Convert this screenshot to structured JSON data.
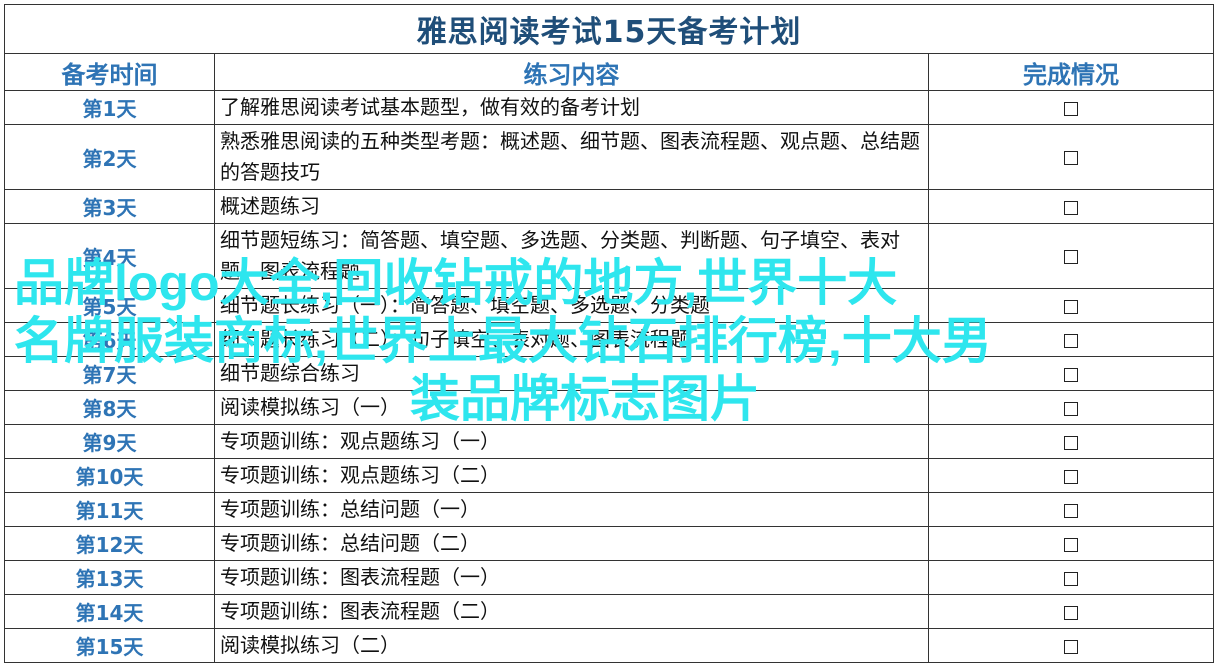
{
  "title": "雅思阅读考试15天备考计划",
  "headers": {
    "time": "备考时间",
    "content": "练习内容",
    "status": "完成情况"
  },
  "rows": [
    {
      "day": "第1天",
      "content": "了解雅思阅读考试基本题型，做有效的备考计划",
      "checked": false
    },
    {
      "day": "第2天",
      "content": "熟悉雅思阅读的五种类型考题：概述题、细节题、图表流程题、观点题、总结题的答题技巧",
      "checked": false
    },
    {
      "day": "第3天",
      "content": "概述题练习",
      "checked": false
    },
    {
      "day": "第4天",
      "content": "细节题短练习：简答题、填空题、多选题、分类题、判断题、句子填空、表对题、图表流程题",
      "checked": false
    },
    {
      "day": "第5天",
      "content": "细节题长练习（一）：简答题、填空题、多选题、分类题",
      "checked": false
    },
    {
      "day": "第6天",
      "content": "细节题长练习（二）：句子填空、表对题、图表流程题",
      "checked": false
    },
    {
      "day": "第7天",
      "content": "细节题综合练习",
      "checked": false
    },
    {
      "day": "第8天",
      "content": "阅读模拟练习（一）",
      "checked": false
    },
    {
      "day": "第9天",
      "content": "专项题训练：观点题练习（一）",
      "checked": false
    },
    {
      "day": "第10天",
      "content": "专项题训练：观点题练习（二）",
      "checked": false
    },
    {
      "day": "第11天",
      "content": "专项题训练：总结问题（一）",
      "checked": false
    },
    {
      "day": "第12天",
      "content": "专项题训练：总结问题（二）",
      "checked": false
    },
    {
      "day": "第13天",
      "content": "专项题训练：图表流程题（一）",
      "checked": false
    },
    {
      "day": "第14天",
      "content": "专项题训练：图表流程题（二）",
      "checked": false
    },
    {
      "day": "第15天",
      "content": "阅读模拟练习（二）",
      "checked": false
    }
  ],
  "checkbox_symbol": "☐",
  "overlay": {
    "line1": "品牌logo大全,回收钻戒的地方,世界十大",
    "line2": "名牌服装商标,世界上最大钻石排行榜,十大男",
    "line3": "装品牌标志图片"
  },
  "colors": {
    "title": "#1f4e79",
    "header": "#2e74b5",
    "day": "#2e74b5",
    "overlay": "#2ee6ee",
    "border": "#333333"
  }
}
